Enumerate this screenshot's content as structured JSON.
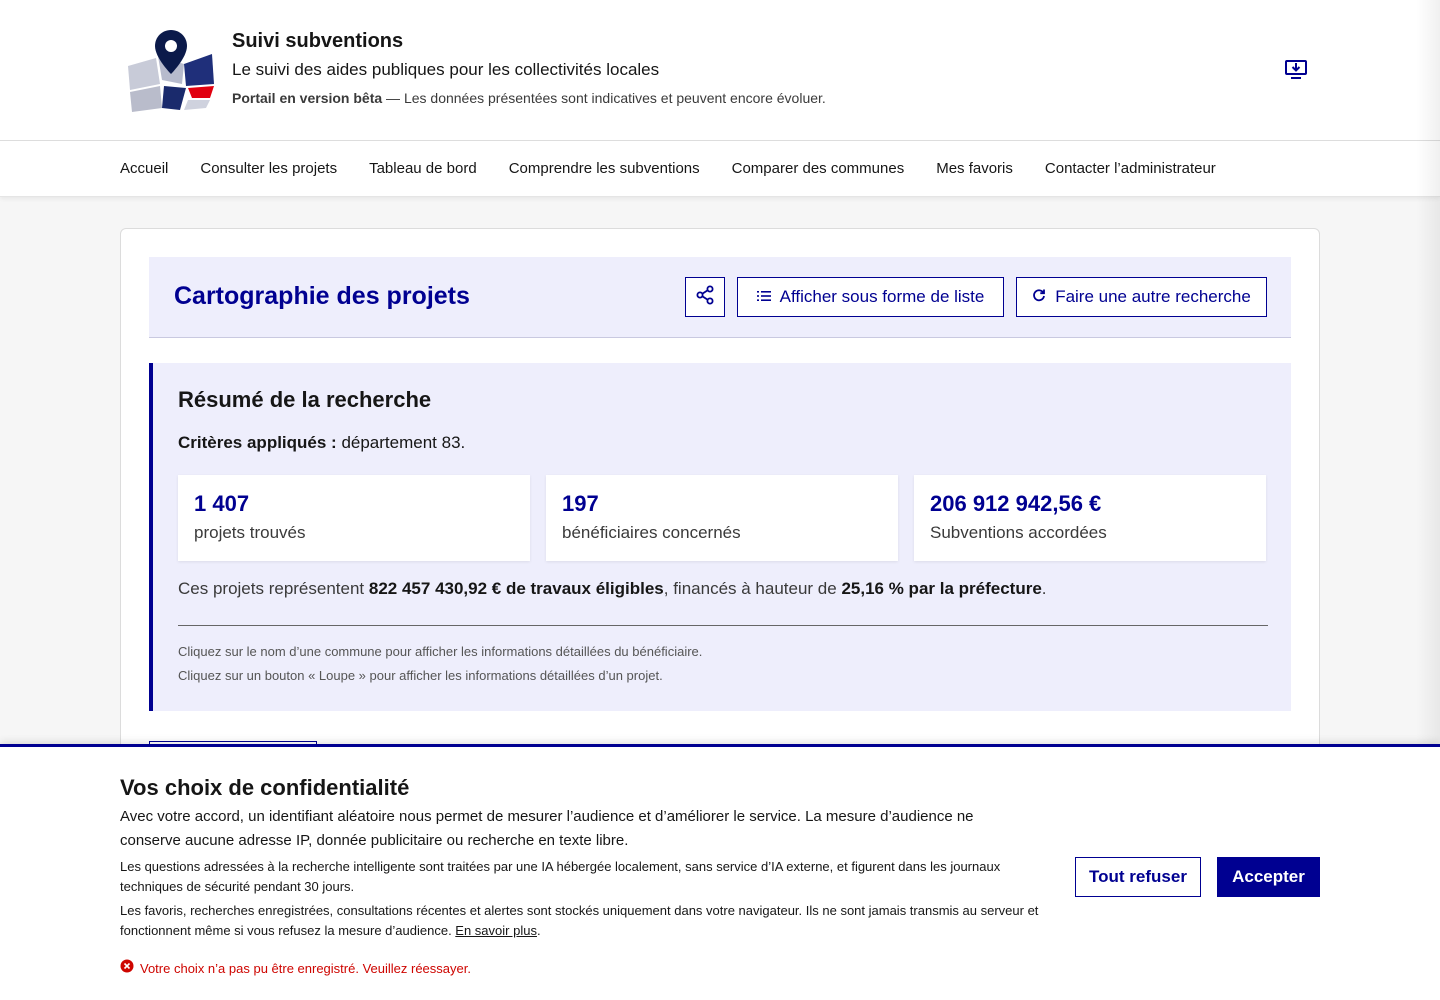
{
  "colors": {
    "primary": "#000091",
    "primary_light_bg": "#eeeefc",
    "error": "#ce0500",
    "marianne_red": "#e1000f"
  },
  "header": {
    "logo_icon": "map-pin-logo-icon",
    "title": "Suivi subventions",
    "tagline": "Le suivi des aides publiques pour les collectivités locales",
    "beta_label": "Portail en version bêta",
    "beta_text": " — Les données présentées sont indicatives et peuvent encore évoluer.",
    "install_icon": "download-computer-icon"
  },
  "nav": {
    "items": [
      {
        "label": "Accueil"
      },
      {
        "label": "Consulter les projets"
      },
      {
        "label": "Tableau de bord"
      },
      {
        "label": "Comprendre les subventions"
      },
      {
        "label": "Comparer des communes"
      },
      {
        "label": "Mes favoris"
      },
      {
        "label": "Contacter l’administrateur"
      }
    ]
  },
  "main": {
    "title": "Cartographie des projets",
    "share_icon": "share-icon",
    "list_button": {
      "label": "Afficher sous forme de liste",
      "icon": "list-icon"
    },
    "search_button": {
      "label": "Faire une autre recherche",
      "icon": "refresh-icon"
    }
  },
  "summary": {
    "title": "Résumé de la recherche",
    "criteria_label": "Critères appliqués :",
    "criteria_value": " département 83.",
    "stats": [
      {
        "value": "1 407",
        "label": "projets trouvés"
      },
      {
        "value": "197",
        "label": "bénéficiaires concernés"
      },
      {
        "value": "206 912 942,56 €",
        "label": "Subventions accordées"
      }
    ],
    "recap": {
      "prefix": "Ces projets représentent ",
      "works": "822 457 430,92 € de travaux éligibles",
      "middle": ", financés à hauteur de ",
      "rate": "25,16 % par la préfecture",
      "suffix": "."
    },
    "help_1": "Cliquez sur le nom d’une commune pour afficher les informations détaillées du bénéficiaire.",
    "help_2": "Cliquez sur un bouton « Loupe » pour afficher les informations détaillées d’un projet."
  },
  "consent": {
    "title": "Vos choix de confidentialité",
    "main_text": "Avec votre accord, un identifiant aléatoire nous permet de mesurer l’audience et d’améliorer le service. La mesure d’audience ne conserve aucune adresse IP, donnée publicitaire ou recherche en texte libre.",
    "ia_text": "Les questions adressées à la recherche intelligente sont traitées par une IA hébergée localement, sans service d’IA externe, et figurent dans les journaux techniques de sécurité pendant 30 jours.",
    "favorites_text": "Les favoris, recherches enregistrées, consultations récentes et alertes sont stockés uniquement dans votre navigateur. Ils ne sont jamais transmis au serveur et fonctionnent même si vous refusez la mesure d’audience. ",
    "learn_more": "En savoir plus",
    "learn_more_suffix": ".",
    "error_icon": "error-circle-icon",
    "error_text": "Votre choix n’a pas pu être enregistré. Veuillez réessayer.",
    "refuse_label": "Tout refuser",
    "accept_label": "Accepter"
  }
}
